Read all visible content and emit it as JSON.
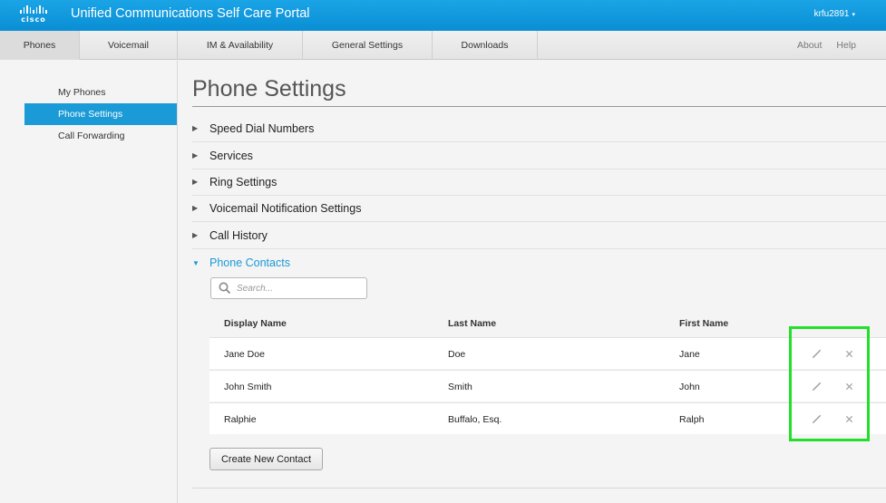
{
  "header": {
    "logo_text": "cisco",
    "title": "Unified Communications Self Care Portal",
    "user": "krfu2891",
    "user_caret": "▾"
  },
  "nav": {
    "tabs": [
      {
        "label": "Phones",
        "active": true
      },
      {
        "label": "Voicemail"
      },
      {
        "label": "IM & Availability"
      },
      {
        "label": "General Settings"
      },
      {
        "label": "Downloads"
      }
    ],
    "right": [
      {
        "label": "About"
      },
      {
        "label": "Help"
      }
    ]
  },
  "sidebar": {
    "items": [
      {
        "label": "My Phones"
      },
      {
        "label": "Phone Settings",
        "active": true
      },
      {
        "label": "Call Forwarding"
      }
    ]
  },
  "main": {
    "title": "Phone Settings",
    "sections": [
      {
        "label": "Speed Dial Numbers",
        "arrow": "▶"
      },
      {
        "label": "Services",
        "arrow": "▶"
      },
      {
        "label": "Ring Settings",
        "arrow": "▶"
      },
      {
        "label": "Voicemail Notification Settings",
        "arrow": "▶"
      },
      {
        "label": "Call History",
        "arrow": "▶"
      },
      {
        "label": "Phone Contacts",
        "arrow": "▼",
        "expanded": true
      }
    ],
    "contacts": {
      "search_placeholder": "Search...",
      "columns": [
        "Display Name",
        "Last Name",
        "First Name"
      ],
      "rows": [
        {
          "display": "Jane Doe",
          "last": "Doe",
          "first": "Jane"
        },
        {
          "display": "John Smith",
          "last": "Smith",
          "first": "John"
        },
        {
          "display": "Ralphie",
          "last": "Buffalo, Esq.",
          "first": "Ralph"
        }
      ],
      "edit_icon": "pencil-icon",
      "delete_icon": "x-icon",
      "create_button": "Create New Contact"
    }
  },
  "colors": {
    "header": "#0a8ed4",
    "accent": "#1a9ad6",
    "highlight": "#22e02a"
  }
}
